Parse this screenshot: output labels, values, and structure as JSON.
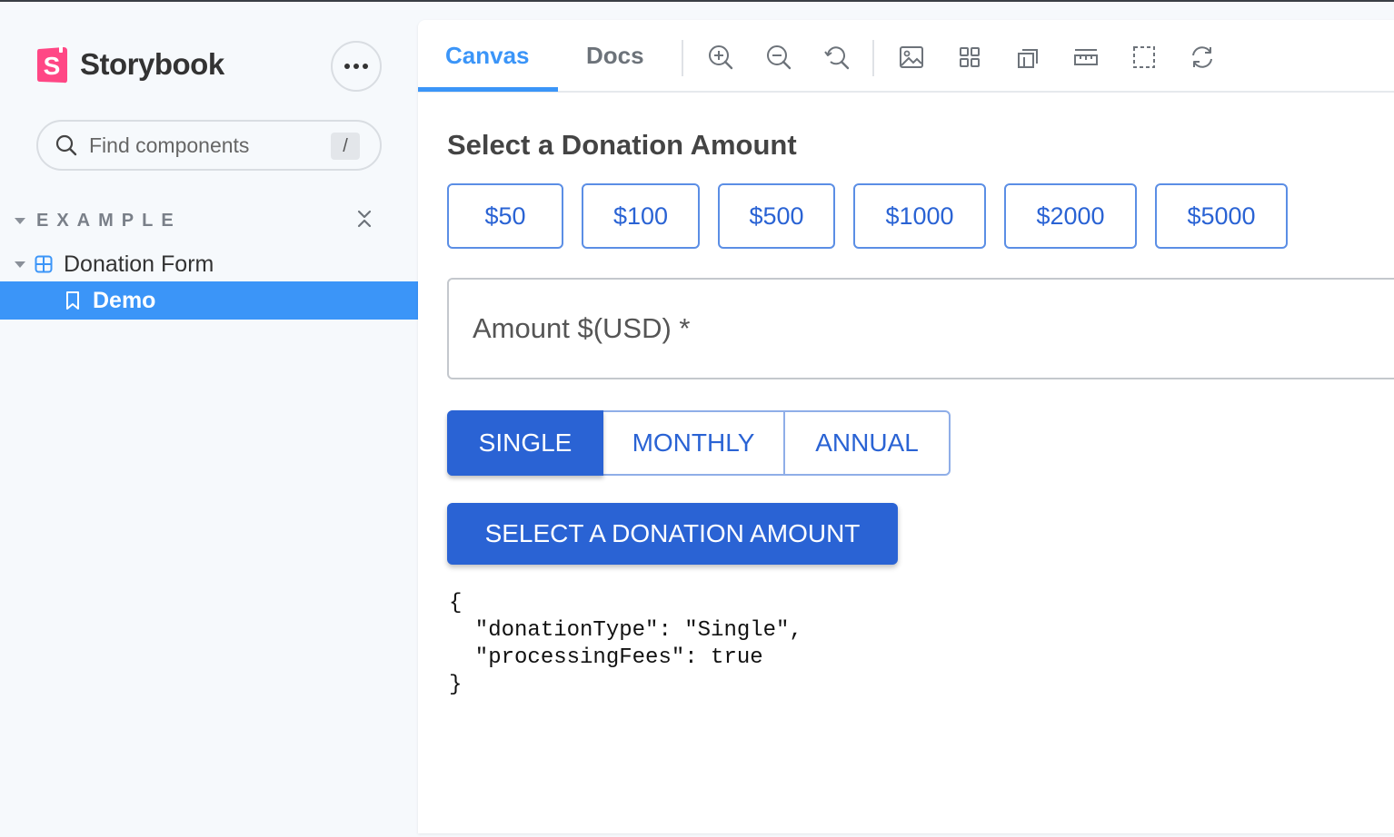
{
  "sidebar": {
    "brand_name": "Storybook",
    "search": {
      "placeholder": "Find components",
      "shortcut": "/"
    },
    "section_title": "EXAMPLE",
    "component_label": "Donation Form",
    "story_label": "Demo"
  },
  "toolbar": {
    "tabs": [
      {
        "label": "Canvas",
        "active": true
      },
      {
        "label": "Docs",
        "active": false
      }
    ],
    "tools": [
      "zoom-in-icon",
      "zoom-out-icon",
      "zoom-reset-icon",
      "background-icon",
      "grid-icon",
      "outline-icon",
      "measure-icon",
      "viewport-icon",
      "remount-icon"
    ]
  },
  "form": {
    "title": "Select a Donation Amount",
    "amounts": [
      "$50",
      "$100",
      "$500",
      "$1000",
      "$2000",
      "$5000"
    ],
    "amount_label": "Amount $(USD) *",
    "frequencies": [
      "SINGLE",
      "MONTHLY",
      "ANNUAL"
    ],
    "selected_frequency": "SINGLE",
    "submit_label": "SELECT A DONATION AMOUNT",
    "output_lines": [
      "{",
      "  \"donationType\": \"Single\",",
      "  \"processingFees\": true",
      "}"
    ]
  },
  "colors": {
    "accent": "#3b95f8",
    "primary": "#2a63d4",
    "brand": "#ff4785"
  }
}
